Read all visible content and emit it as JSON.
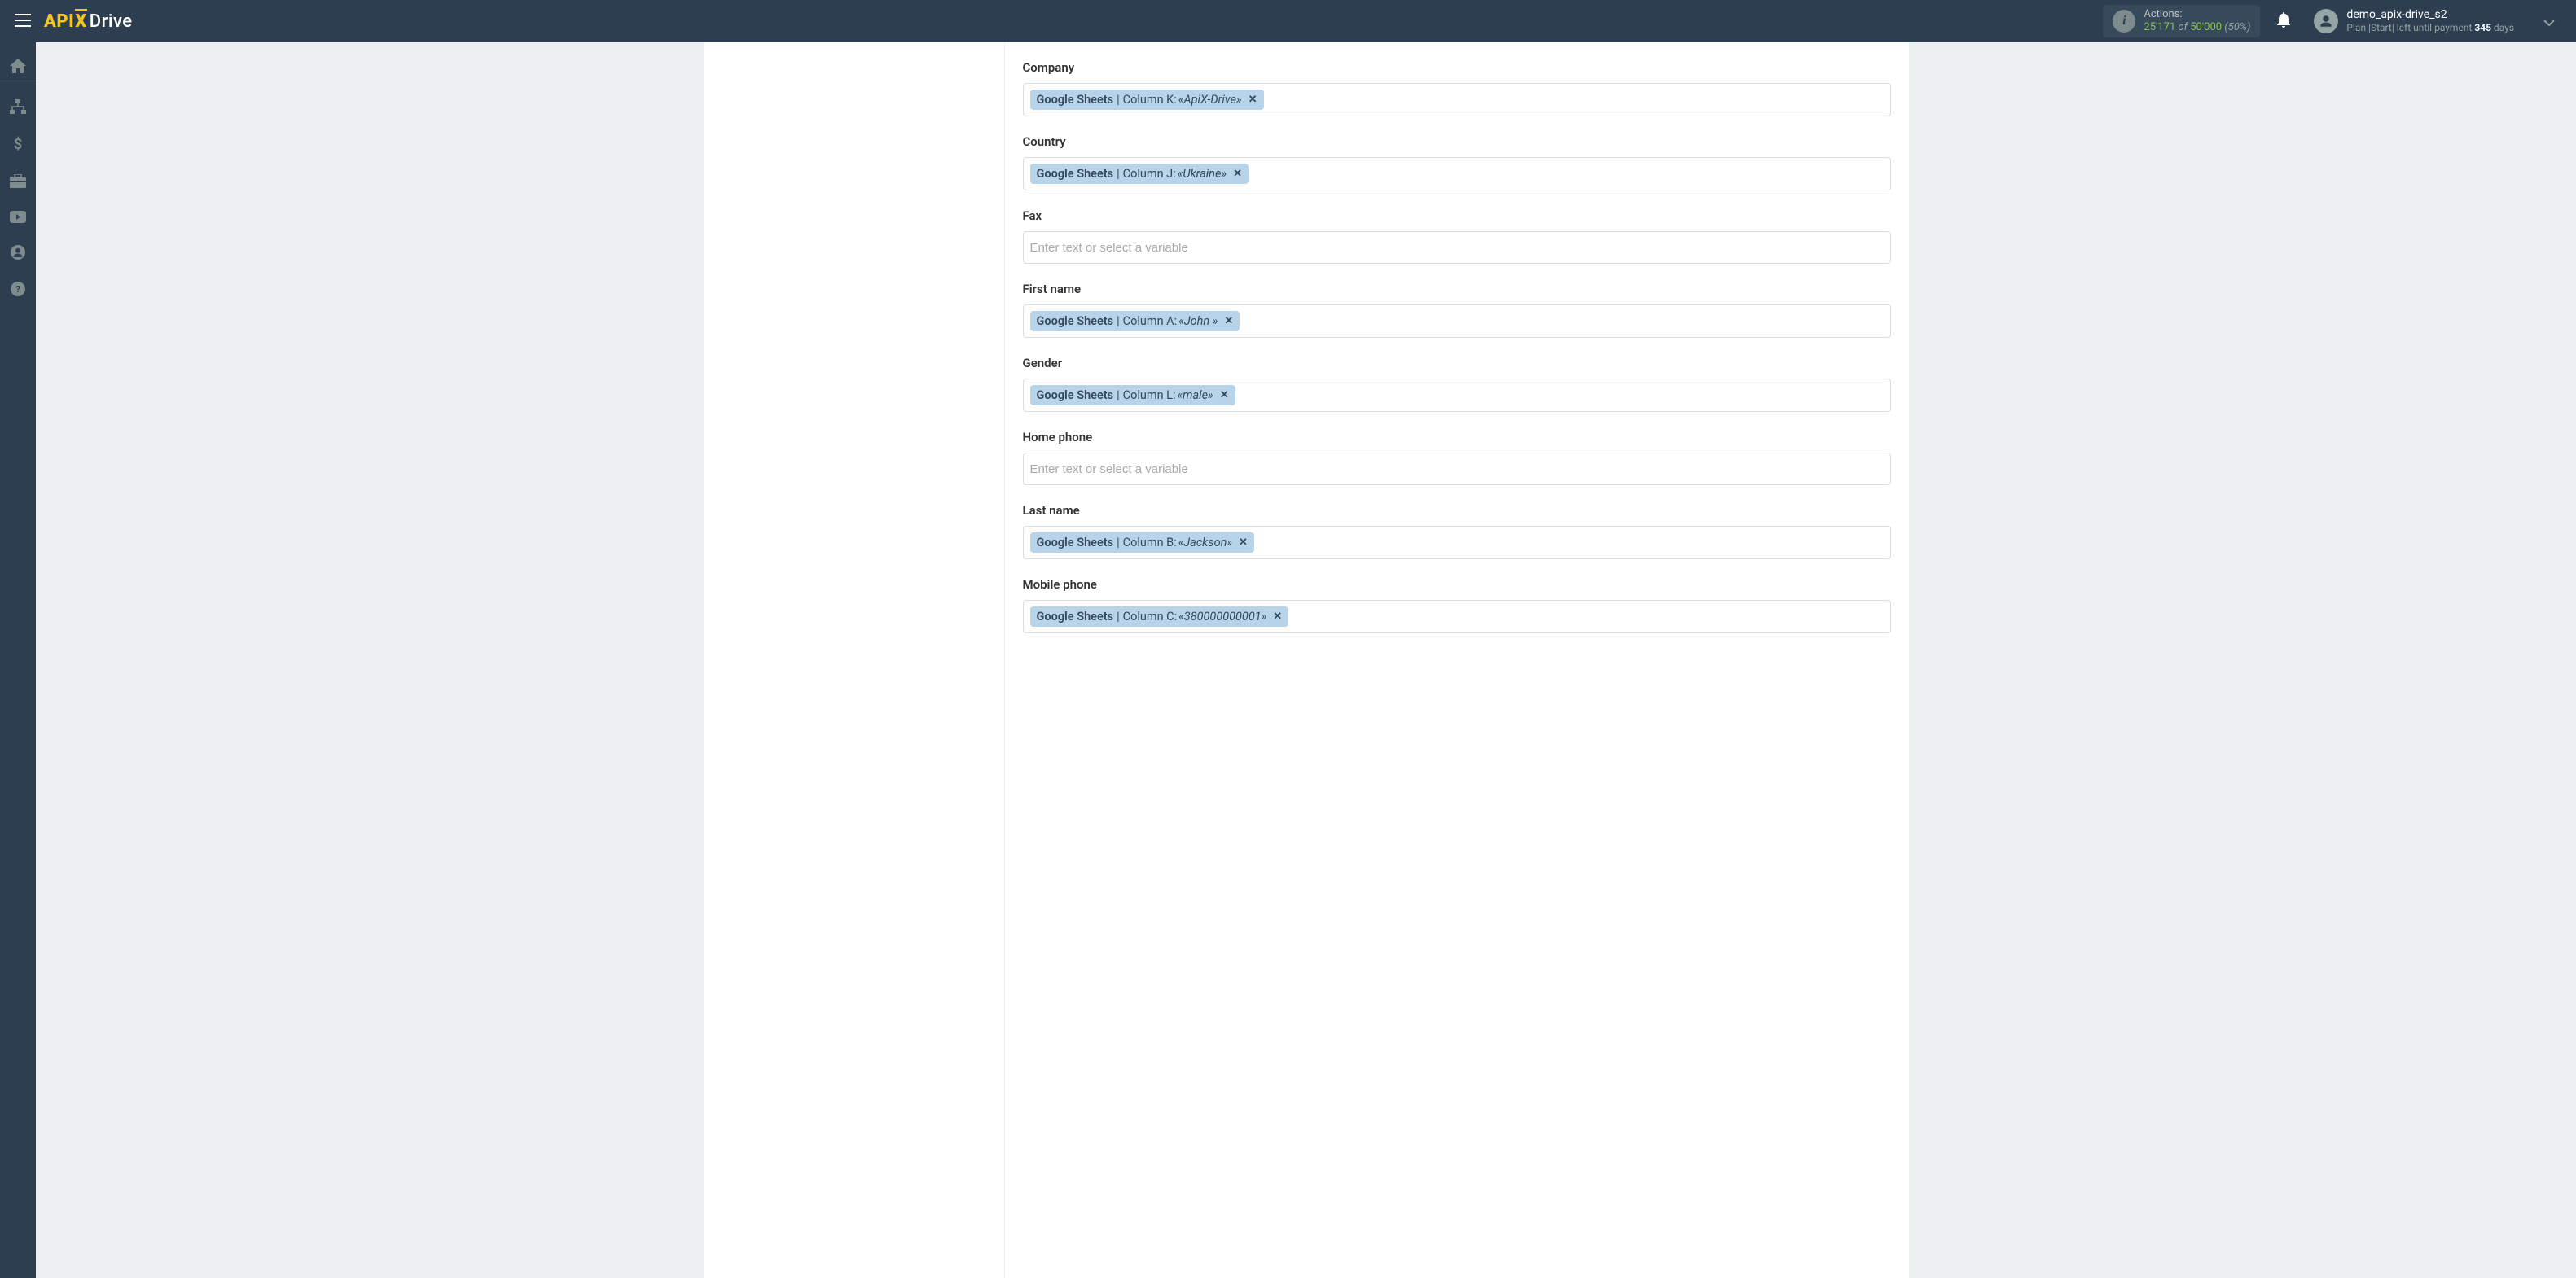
{
  "header": {
    "logo": {
      "api": "API",
      "x": "X",
      "drive": "Drive"
    },
    "actions": {
      "label": "Actions:",
      "current": "25'171",
      "of": "of",
      "total": "50'000",
      "percent": "(50%)"
    },
    "user": {
      "name": "demo_apix-drive_s2",
      "plan_prefix": "Plan |Start| left until payment ",
      "days_num": "345",
      "days_suffix": " days"
    }
  },
  "fields": [
    {
      "label": "Company",
      "placeholder": "",
      "tags": [
        {
          "source": "Google Sheets",
          "sep": " | ",
          "column": "Column K: ",
          "value": "«ApiX-Drive»"
        }
      ]
    },
    {
      "label": "Country",
      "placeholder": "",
      "tags": [
        {
          "source": "Google Sheets",
          "sep": " | ",
          "column": "Column J: ",
          "value": "«Ukraine»"
        }
      ]
    },
    {
      "label": "Fax",
      "placeholder": "Enter text or select a variable",
      "tags": []
    },
    {
      "label": "First name",
      "placeholder": "",
      "tags": [
        {
          "source": "Google Sheets",
          "sep": " | ",
          "column": "Column A: ",
          "value": "«John »"
        }
      ]
    },
    {
      "label": "Gender",
      "placeholder": "",
      "tags": [
        {
          "source": "Google Sheets",
          "sep": " | ",
          "column": "Column L: ",
          "value": "«male»"
        }
      ]
    },
    {
      "label": "Home phone",
      "placeholder": "Enter text or select a variable",
      "tags": []
    },
    {
      "label": "Last name",
      "placeholder": "",
      "tags": [
        {
          "source": "Google Sheets",
          "sep": " | ",
          "column": "Column B: ",
          "value": "«Jackson»"
        }
      ]
    },
    {
      "label": "Mobile phone",
      "placeholder": "",
      "tags": [
        {
          "source": "Google Sheets",
          "sep": " | ",
          "column": "Column C: ",
          "value": "«380000000001»"
        }
      ]
    }
  ],
  "sidebar": {
    "items": [
      "home",
      "connections",
      "billing",
      "briefcase",
      "media",
      "account",
      "help"
    ]
  }
}
